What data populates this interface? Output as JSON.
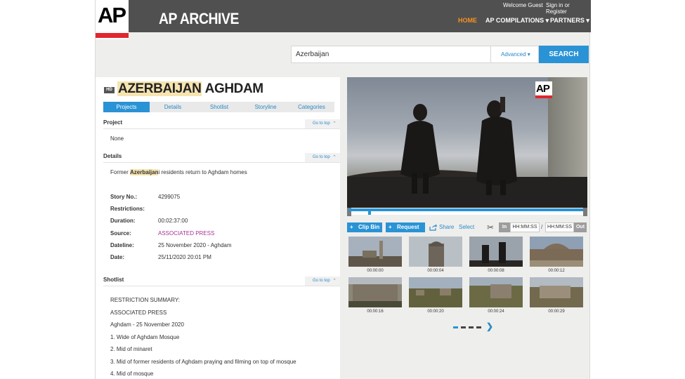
{
  "header": {
    "brand": "AP ARCHIVE",
    "logo": "AP",
    "welcome": "Welcome  Guest",
    "signin": "Sign in or Register",
    "nav": [
      "HOME",
      "AP COMPILATIONS ▾",
      "PARTNERS ▾"
    ]
  },
  "search": {
    "value": "Azerbaijan",
    "advanced": "Advanced ▾",
    "button": "SEARCH"
  },
  "story": {
    "hd": "HD",
    "title_highlight": "AZERBAIJAN",
    "title_rest": " AGHDAM",
    "tabs": [
      "Projects",
      "Details",
      "Shotlist",
      "Storyline",
      "Categories"
    ],
    "sections": {
      "project": "Project",
      "details": "Details",
      "shotlist": "Shotlist",
      "top_link": "Go to top"
    },
    "project_value": "None",
    "summary_pre": "Former ",
    "summary_hl": "Azerbaijan",
    "summary_post": "i residents return to Aghdam homes",
    "fields": {
      "story_no_label": "Story No.:",
      "story_no": "4299075",
      "restrictions_label": "Restrictions:",
      "duration_label": "Duration:",
      "duration": "00:02:37:00",
      "source_label": "Source:",
      "source": "ASSOCIATED PRESS",
      "dateline_label": "Dateline:",
      "dateline": "25 November 2020 - Aghdam",
      "date_label": "Date:",
      "date": "25/11/2020 20:01 PM"
    },
    "shotlist": [
      "RESTRICTION SUMMARY:",
      "ASSOCIATED PRESS",
      "Aghdam - 25 November 2020",
      "1. Wide of Aghdam Mosque",
      "2. Mid of minaret",
      "3. Mid of former residents of Aghdam praying and filming on top of mosque",
      "4. Mid of mosque"
    ]
  },
  "player": {
    "clip_bin": "Clip Bin",
    "request": "Request",
    "share": "Share",
    "select": "Select",
    "in": "In",
    "tc_in": "HH:MM:SS",
    "slash": "/",
    "tc_out": "HH:MM:SS",
    "out": "Out",
    "watermark": "AP"
  },
  "thumbnails": [
    "00:00:00",
    "00:00:04",
    "00:00:08",
    "00:00:12",
    "00:00:16",
    "00:00:20",
    "00:00:24",
    "00:00:29"
  ],
  "pager_next": "❯",
  "colors": {
    "accent": "#2a93d5",
    "brand_red": "#e1262d",
    "home_orange": "#f7931d",
    "source_purple": "#a4338e",
    "highlight": "#f6e4b0"
  }
}
